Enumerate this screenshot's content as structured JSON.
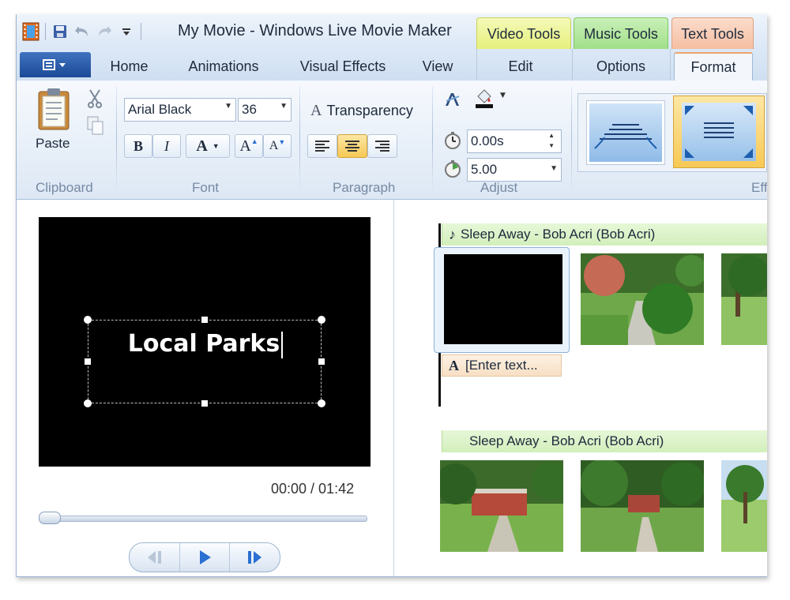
{
  "window": {
    "title": "My Movie - Windows Live Movie Maker"
  },
  "context_tabs": {
    "video": "Video Tools",
    "music": "Music Tools",
    "text": "Text Tools"
  },
  "tabs": {
    "home": "Home",
    "animations": "Animations",
    "visual_effects": "Visual Effects",
    "view": "View",
    "edit": "Edit",
    "options": "Options",
    "format": "Format"
  },
  "ribbon": {
    "clipboard": {
      "paste_label": "Paste",
      "group_label": "Clipboard"
    },
    "font": {
      "family": "Arial Black",
      "size": "36",
      "bold": "B",
      "italic": "I",
      "color_label": "A",
      "grow": "A",
      "shrink": "A",
      "group_label": "Font"
    },
    "paragraph": {
      "transparency_label": "Transparency",
      "transparency_glyph": "A",
      "group_label": "Paragraph"
    },
    "adjust": {
      "start_time": "0.00s",
      "duration": "5.00",
      "group_label": "Adjust"
    },
    "effects": {
      "group_label": "Eff"
    }
  },
  "preview": {
    "text": "Local Parks",
    "timecode": "00:00 / 01:42",
    "progress": 0
  },
  "storyboard": {
    "music_track_1": "Sleep Away - Bob Acri (Bob Acri)",
    "music_track_2": "Sleep Away - Bob Acri (Bob Acri)",
    "caption_placeholder": "[Enter text..."
  },
  "colors": {
    "accent": "#2a6fd2",
    "video_tools": "#e8f27a",
    "music_tools": "#9fe08a",
    "text_tools": "#f6c2a6",
    "active_highlight": "#f7c955"
  }
}
